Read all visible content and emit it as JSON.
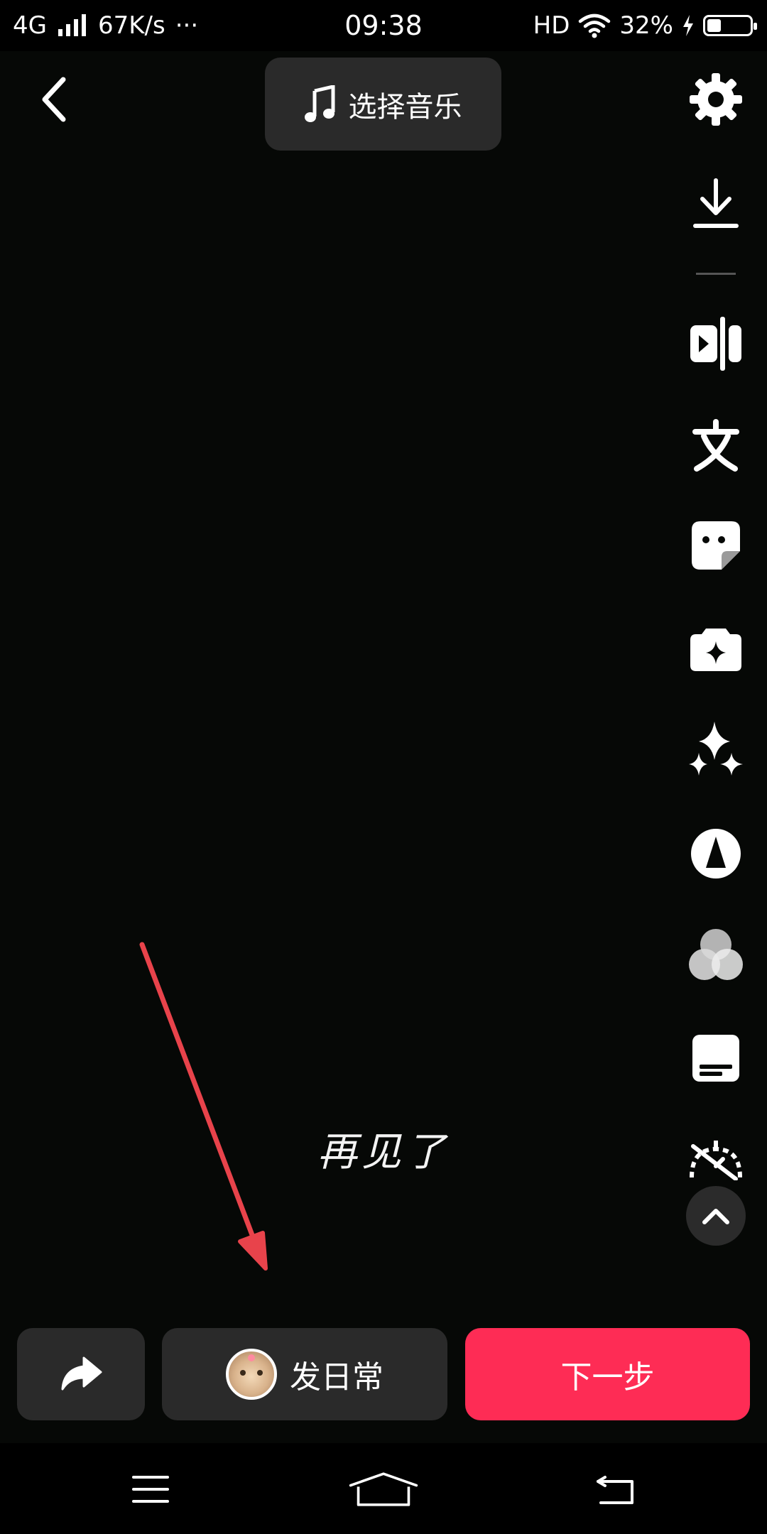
{
  "status_bar": {
    "network": "4G",
    "speed": "67K/s",
    "more": "···",
    "time": "09:38",
    "hd": "HD",
    "battery_percent": "32%",
    "battery_level": 0.32
  },
  "header": {
    "music_label": "选择音乐"
  },
  "tools": [
    {
      "name": "settings",
      "icon": "gear-icon"
    },
    {
      "name": "download",
      "icon": "download-icon"
    },
    {
      "name": "clip",
      "icon": "clip-icon"
    },
    {
      "name": "text",
      "icon": "text-icon"
    },
    {
      "name": "sticker",
      "icon": "sticker-icon"
    },
    {
      "name": "effects",
      "icon": "effects-camera-icon"
    },
    {
      "name": "enhance",
      "icon": "sparkle-icon"
    },
    {
      "name": "template",
      "icon": "cone-icon"
    },
    {
      "name": "filters",
      "icon": "filter-circles-icon"
    },
    {
      "name": "captions",
      "icon": "caption-icon"
    },
    {
      "name": "speed",
      "icon": "speed-icon"
    }
  ],
  "preview": {
    "caption_text": "再见了"
  },
  "bottom": {
    "post_daily_label": "发日常",
    "next_label": "下一步"
  },
  "colors": {
    "accent": "#fe2c55",
    "annotation_arrow": "#e8434b",
    "button_bg": "#2a2a2a"
  }
}
